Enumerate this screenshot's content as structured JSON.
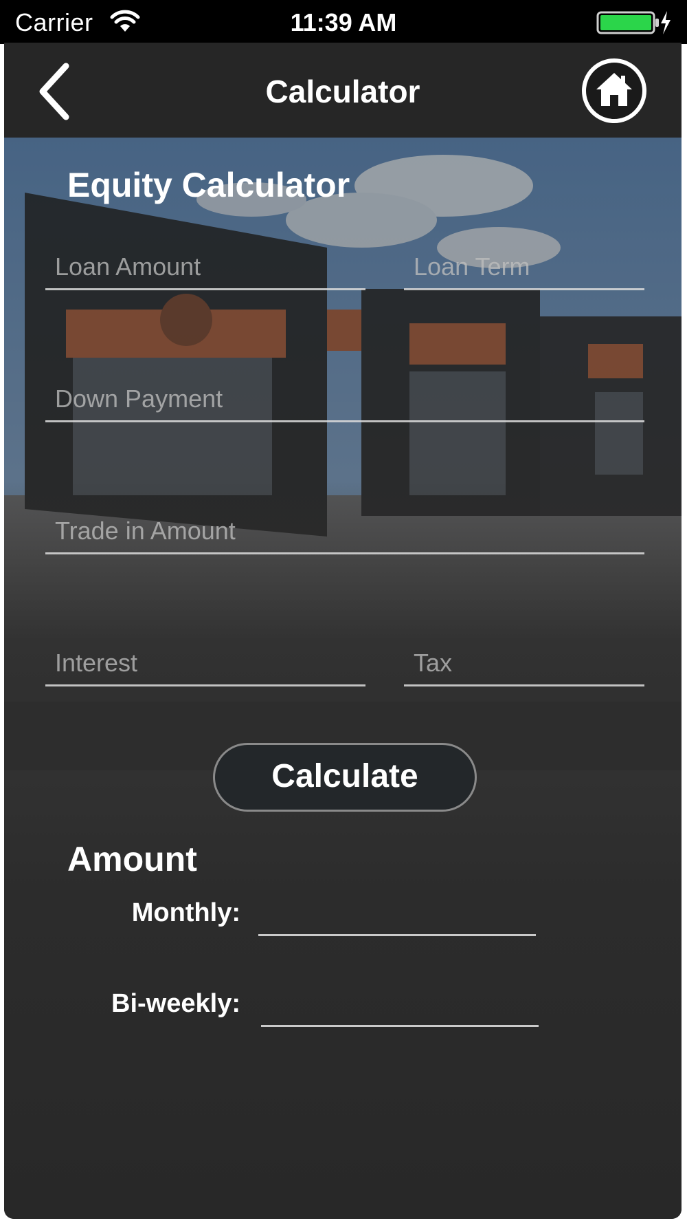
{
  "status_bar": {
    "carrier": "Carrier",
    "time": "11:39 AM",
    "wifi_icon": "wifi-icon",
    "battery_icon": "battery-charging-icon",
    "battery_color": "#2bd54a"
  },
  "nav": {
    "title": "Calculator",
    "back_icon": "chevron-left-icon",
    "home_icon": "home-icon"
  },
  "form": {
    "title": "Equity Calculator",
    "fields": {
      "loan_amount": {
        "placeholder": "Loan Amount",
        "value": ""
      },
      "loan_term": {
        "placeholder": "Loan Term",
        "value": ""
      },
      "down_payment": {
        "placeholder": "Down Payment",
        "value": ""
      },
      "trade_in_amount": {
        "placeholder": "Trade in Amount",
        "value": ""
      },
      "interest": {
        "placeholder": "Interest",
        "value": ""
      },
      "tax": {
        "placeholder": "Tax",
        "value": ""
      }
    },
    "calculate_label": "Calculate"
  },
  "results": {
    "heading": "Amount",
    "monthly_label": "Monthly:",
    "monthly_value": "",
    "biweekly_label": "Bi-weekly:",
    "biweekly_value": ""
  },
  "colors": {
    "nav_background": "#262626",
    "status_background": "#000000",
    "button_background": "#23272a",
    "text": "#ffffff"
  }
}
